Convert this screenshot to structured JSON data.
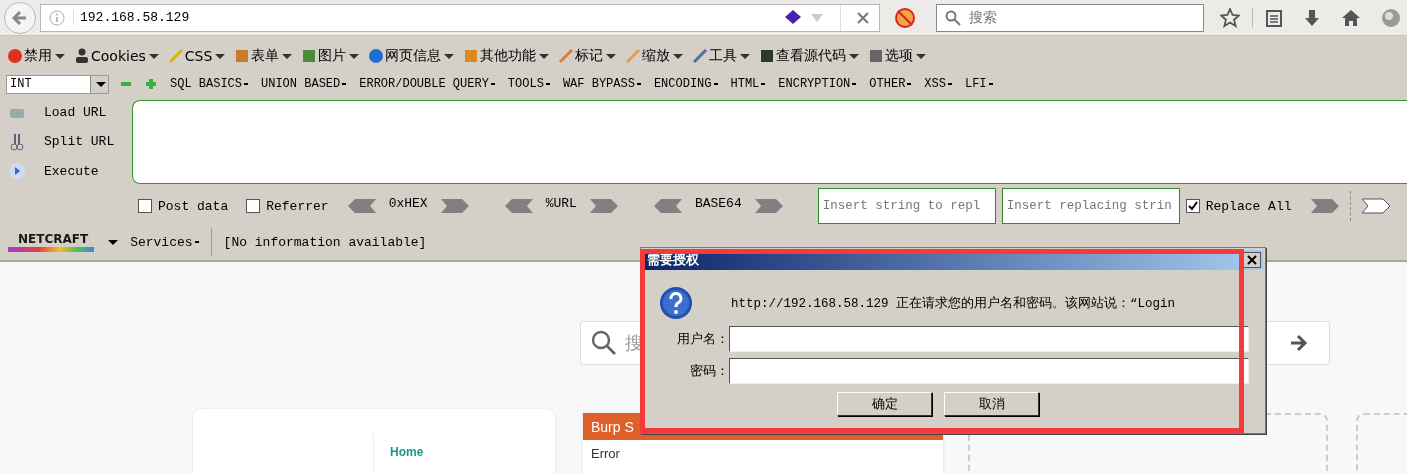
{
  "browser": {
    "url": "192.168.58.129",
    "search_placeholder": "搜索"
  },
  "toolbar": [
    {
      "label": "禁用"
    },
    {
      "label": "Cookies"
    },
    {
      "label": "CSS"
    },
    {
      "label": "表单"
    },
    {
      "label": "图片"
    },
    {
      "label": "网页信息"
    },
    {
      "label": "其他功能"
    },
    {
      "label": "标记"
    },
    {
      "label": "缩放"
    },
    {
      "label": "工具"
    },
    {
      "label": "查看源代码"
    },
    {
      "label": "选项"
    }
  ],
  "hackbar": {
    "select": "INT",
    "menus": [
      "SQL BASICS",
      "UNION BASED",
      "ERROR/DOUBLE QUERY",
      "TOOLS",
      "WAF BYPASS",
      "ENCODING",
      "HTML",
      "ENCRYPTION",
      "OTHER",
      "XSS",
      "LFI"
    ],
    "actions": [
      "Load URL",
      "Split URL",
      "Execute"
    ],
    "post_data": {
      "label": "Post data",
      "checked": false
    },
    "referrer": {
      "label": "Referrer",
      "checked": false
    },
    "encoders": [
      "0xHEX",
      "%URL",
      "BASE64"
    ],
    "find_placeholder": "Insert string to repl",
    "replace_placeholder": "Insert replacing strin",
    "replace_all": {
      "label": "Replace All",
      "checked": true
    }
  },
  "netcraft": {
    "logo": "NETCRAFT",
    "services": "Services",
    "info": "[No information available]"
  },
  "page": {
    "search_placeholder": "搜",
    "nav_items": [
      "Home"
    ],
    "panel": {
      "title": "Burp S",
      "body": "Error"
    }
  },
  "dialog": {
    "title": "需要授权",
    "message": "http://192.168.58.129 正在请求您的用户名和密码。该网站说：“Login",
    "fields": [
      {
        "label": "用户名："
      },
      {
        "label": "密码："
      }
    ],
    "buttons": [
      "确定",
      "取消"
    ]
  }
}
